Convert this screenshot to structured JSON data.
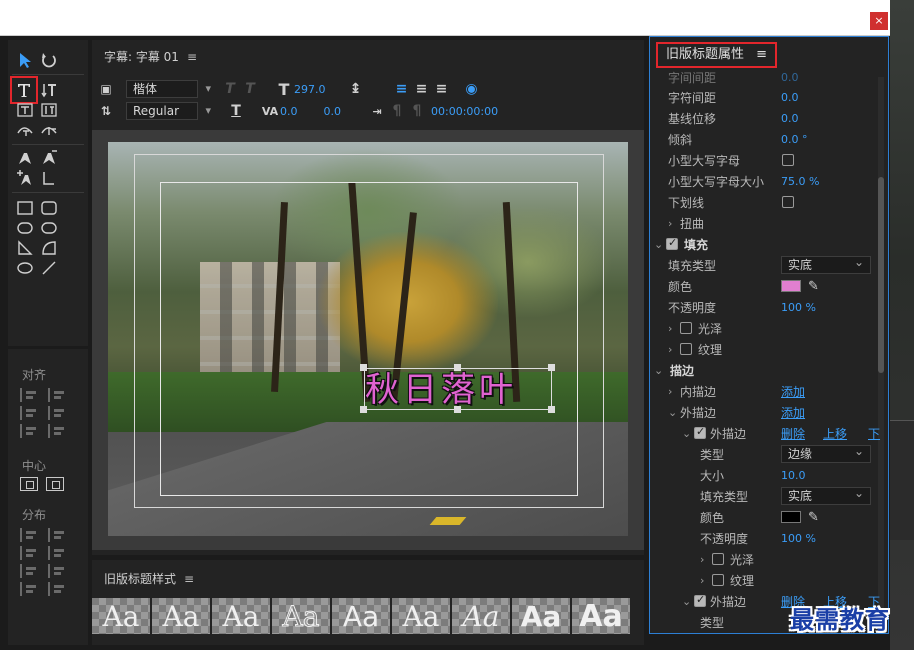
{
  "window": {
    "close_glyph": "×"
  },
  "tools_panel": {
    "align_label": "对齐",
    "center_label": "中心",
    "distribute_label": "分布"
  },
  "main_panel": {
    "title": "字幕: 字幕 01",
    "menu_glyph": "≡",
    "font_family": "楷体",
    "font_style": "Regular",
    "font_size": "297.0",
    "leading": "0.0",
    "kerning": "0.0",
    "tracking": "0.0",
    "timecode": "00:00:00:00",
    "title_text": "秋日落叶"
  },
  "styles_panel": {
    "title": "旧版标题样式",
    "menu_glyph": "≡",
    "swatches": [
      "Aa",
      "Aa",
      "Aa",
      "Aa",
      "Aa",
      "Aa",
      "Aa",
      "Aa",
      "Aa"
    ]
  },
  "properties": {
    "title": "旧版标题属性",
    "menu_glyph": "≡",
    "rows": {
      "char_spacing_top": {
        "label": "字间间距",
        "value": "0.0"
      },
      "tracking": {
        "label": "字符间距",
        "value": "0.0"
      },
      "baseline": {
        "label": "基线位移",
        "value": "0.0"
      },
      "slant": {
        "label": "倾斜",
        "value": "0.0 °"
      },
      "small_caps": {
        "label": "小型大写字母"
      },
      "small_caps_size": {
        "label": "小型大写字母大小",
        "value": "75.0 %"
      },
      "underline": {
        "label": "下划线"
      },
      "distort": {
        "label": "扭曲"
      },
      "fill": {
        "label": "填充"
      },
      "fill_type": {
        "label": "填充类型",
        "value": "实底"
      },
      "color": {
        "label": "颜色",
        "value": "#e07fd0"
      },
      "opacity": {
        "label": "不透明度",
        "value": "100 %"
      },
      "sheen": {
        "label": "光泽"
      },
      "texture": {
        "label": "纹理"
      },
      "stroke": {
        "label": "描边"
      },
      "inner_stroke": {
        "label": "内描边",
        "action": "添加"
      },
      "outer_stroke": {
        "label": "外描边",
        "action": "添加"
      },
      "outer_stroke_item": {
        "label": "外描边",
        "delete": "删除",
        "move_up": "上移",
        "move_down": "下"
      },
      "stroke_type": {
        "label": "类型",
        "value": "边缘"
      },
      "stroke_size": {
        "label": "大小",
        "value": "10.0"
      },
      "stroke_fill_type": {
        "label": "填充类型",
        "value": "实底"
      },
      "stroke_color": {
        "label": "颜色",
        "value": "#000000"
      },
      "stroke_opacity": {
        "label": "不透明度",
        "value": "100 %"
      },
      "stroke_sheen": {
        "label": "光泽"
      },
      "stroke_texture": {
        "label": "纹理"
      },
      "outer_stroke_item2": {
        "label": "外描边",
        "delete": "删除",
        "move_up": "上移",
        "move_down": "下"
      },
      "stroke2_type": {
        "label": "类型"
      }
    }
  },
  "watermark": "最需教育",
  "colors": {
    "accent_blue": "#3b9df7",
    "highlight_red": "#e3262c",
    "title_fill": "#e063d0"
  }
}
